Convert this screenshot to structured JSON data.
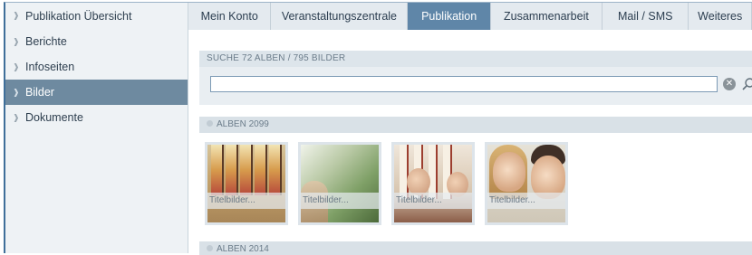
{
  "sidebar": {
    "items": [
      {
        "label": "Publikation Übersicht"
      },
      {
        "label": "Berichte"
      },
      {
        "label": "Infoseiten"
      },
      {
        "label": "Bilder"
      },
      {
        "label": "Dokumente"
      }
    ],
    "active_index": 3
  },
  "nav": {
    "tabs": [
      {
        "label": "Mein Konto"
      },
      {
        "label": "Veranstaltungszentrale"
      },
      {
        "label": "Publikation"
      },
      {
        "label": "Zusammenarbeit"
      },
      {
        "label": "Mail / SMS"
      },
      {
        "label": "Weiteres"
      }
    ],
    "active_index": 2
  },
  "search": {
    "title": "SUCHE  72 ALBEN  /  795 BILDER",
    "value": "",
    "placeholder": "",
    "clear_icon": "clear-icon",
    "search_icon": "magnifier-icon"
  },
  "albums": [
    {
      "header": "ALBEN 2099",
      "images": [
        {
          "caption": "Titelbilder..."
        },
        {
          "caption": "Titelbilder..."
        },
        {
          "caption": "Titelbilder..."
        },
        {
          "caption": "Titelbilder..."
        }
      ]
    },
    {
      "header": "ALBEN 2014",
      "images": []
    }
  ],
  "colors": {
    "accent": "#5f86a8",
    "sidebar_active": "#6e8aa0",
    "frame": "#3f6f9a"
  }
}
